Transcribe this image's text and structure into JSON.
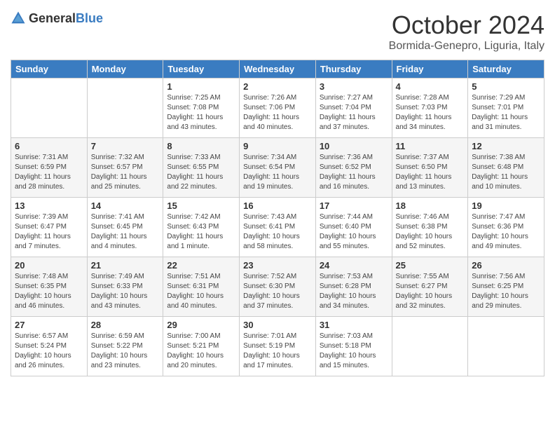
{
  "header": {
    "logo_general": "General",
    "logo_blue": "Blue",
    "month": "October 2024",
    "location": "Bormida-Genepro, Liguria, Italy"
  },
  "days_of_week": [
    "Sunday",
    "Monday",
    "Tuesday",
    "Wednesday",
    "Thursday",
    "Friday",
    "Saturday"
  ],
  "weeks": [
    [
      {
        "day": "",
        "info": ""
      },
      {
        "day": "",
        "info": ""
      },
      {
        "day": "1",
        "info": "Sunrise: 7:25 AM\nSunset: 7:08 PM\nDaylight: 11 hours and 43 minutes."
      },
      {
        "day": "2",
        "info": "Sunrise: 7:26 AM\nSunset: 7:06 PM\nDaylight: 11 hours and 40 minutes."
      },
      {
        "day": "3",
        "info": "Sunrise: 7:27 AM\nSunset: 7:04 PM\nDaylight: 11 hours and 37 minutes."
      },
      {
        "day": "4",
        "info": "Sunrise: 7:28 AM\nSunset: 7:03 PM\nDaylight: 11 hours and 34 minutes."
      },
      {
        "day": "5",
        "info": "Sunrise: 7:29 AM\nSunset: 7:01 PM\nDaylight: 11 hours and 31 minutes."
      }
    ],
    [
      {
        "day": "6",
        "info": "Sunrise: 7:31 AM\nSunset: 6:59 PM\nDaylight: 11 hours and 28 minutes."
      },
      {
        "day": "7",
        "info": "Sunrise: 7:32 AM\nSunset: 6:57 PM\nDaylight: 11 hours and 25 minutes."
      },
      {
        "day": "8",
        "info": "Sunrise: 7:33 AM\nSunset: 6:55 PM\nDaylight: 11 hours and 22 minutes."
      },
      {
        "day": "9",
        "info": "Sunrise: 7:34 AM\nSunset: 6:54 PM\nDaylight: 11 hours and 19 minutes."
      },
      {
        "day": "10",
        "info": "Sunrise: 7:36 AM\nSunset: 6:52 PM\nDaylight: 11 hours and 16 minutes."
      },
      {
        "day": "11",
        "info": "Sunrise: 7:37 AM\nSunset: 6:50 PM\nDaylight: 11 hours and 13 minutes."
      },
      {
        "day": "12",
        "info": "Sunrise: 7:38 AM\nSunset: 6:48 PM\nDaylight: 11 hours and 10 minutes."
      }
    ],
    [
      {
        "day": "13",
        "info": "Sunrise: 7:39 AM\nSunset: 6:47 PM\nDaylight: 11 hours and 7 minutes."
      },
      {
        "day": "14",
        "info": "Sunrise: 7:41 AM\nSunset: 6:45 PM\nDaylight: 11 hours and 4 minutes."
      },
      {
        "day": "15",
        "info": "Sunrise: 7:42 AM\nSunset: 6:43 PM\nDaylight: 11 hours and 1 minute."
      },
      {
        "day": "16",
        "info": "Sunrise: 7:43 AM\nSunset: 6:41 PM\nDaylight: 10 hours and 58 minutes."
      },
      {
        "day": "17",
        "info": "Sunrise: 7:44 AM\nSunset: 6:40 PM\nDaylight: 10 hours and 55 minutes."
      },
      {
        "day": "18",
        "info": "Sunrise: 7:46 AM\nSunset: 6:38 PM\nDaylight: 10 hours and 52 minutes."
      },
      {
        "day": "19",
        "info": "Sunrise: 7:47 AM\nSunset: 6:36 PM\nDaylight: 10 hours and 49 minutes."
      }
    ],
    [
      {
        "day": "20",
        "info": "Sunrise: 7:48 AM\nSunset: 6:35 PM\nDaylight: 10 hours and 46 minutes."
      },
      {
        "day": "21",
        "info": "Sunrise: 7:49 AM\nSunset: 6:33 PM\nDaylight: 10 hours and 43 minutes."
      },
      {
        "day": "22",
        "info": "Sunrise: 7:51 AM\nSunset: 6:31 PM\nDaylight: 10 hours and 40 minutes."
      },
      {
        "day": "23",
        "info": "Sunrise: 7:52 AM\nSunset: 6:30 PM\nDaylight: 10 hours and 37 minutes."
      },
      {
        "day": "24",
        "info": "Sunrise: 7:53 AM\nSunset: 6:28 PM\nDaylight: 10 hours and 34 minutes."
      },
      {
        "day": "25",
        "info": "Sunrise: 7:55 AM\nSunset: 6:27 PM\nDaylight: 10 hours and 32 minutes."
      },
      {
        "day": "26",
        "info": "Sunrise: 7:56 AM\nSunset: 6:25 PM\nDaylight: 10 hours and 29 minutes."
      }
    ],
    [
      {
        "day": "27",
        "info": "Sunrise: 6:57 AM\nSunset: 5:24 PM\nDaylight: 10 hours and 26 minutes."
      },
      {
        "day": "28",
        "info": "Sunrise: 6:59 AM\nSunset: 5:22 PM\nDaylight: 10 hours and 23 minutes."
      },
      {
        "day": "29",
        "info": "Sunrise: 7:00 AM\nSunset: 5:21 PM\nDaylight: 10 hours and 20 minutes."
      },
      {
        "day": "30",
        "info": "Sunrise: 7:01 AM\nSunset: 5:19 PM\nDaylight: 10 hours and 17 minutes."
      },
      {
        "day": "31",
        "info": "Sunrise: 7:03 AM\nSunset: 5:18 PM\nDaylight: 10 hours and 15 minutes."
      },
      {
        "day": "",
        "info": ""
      },
      {
        "day": "",
        "info": ""
      }
    ]
  ]
}
